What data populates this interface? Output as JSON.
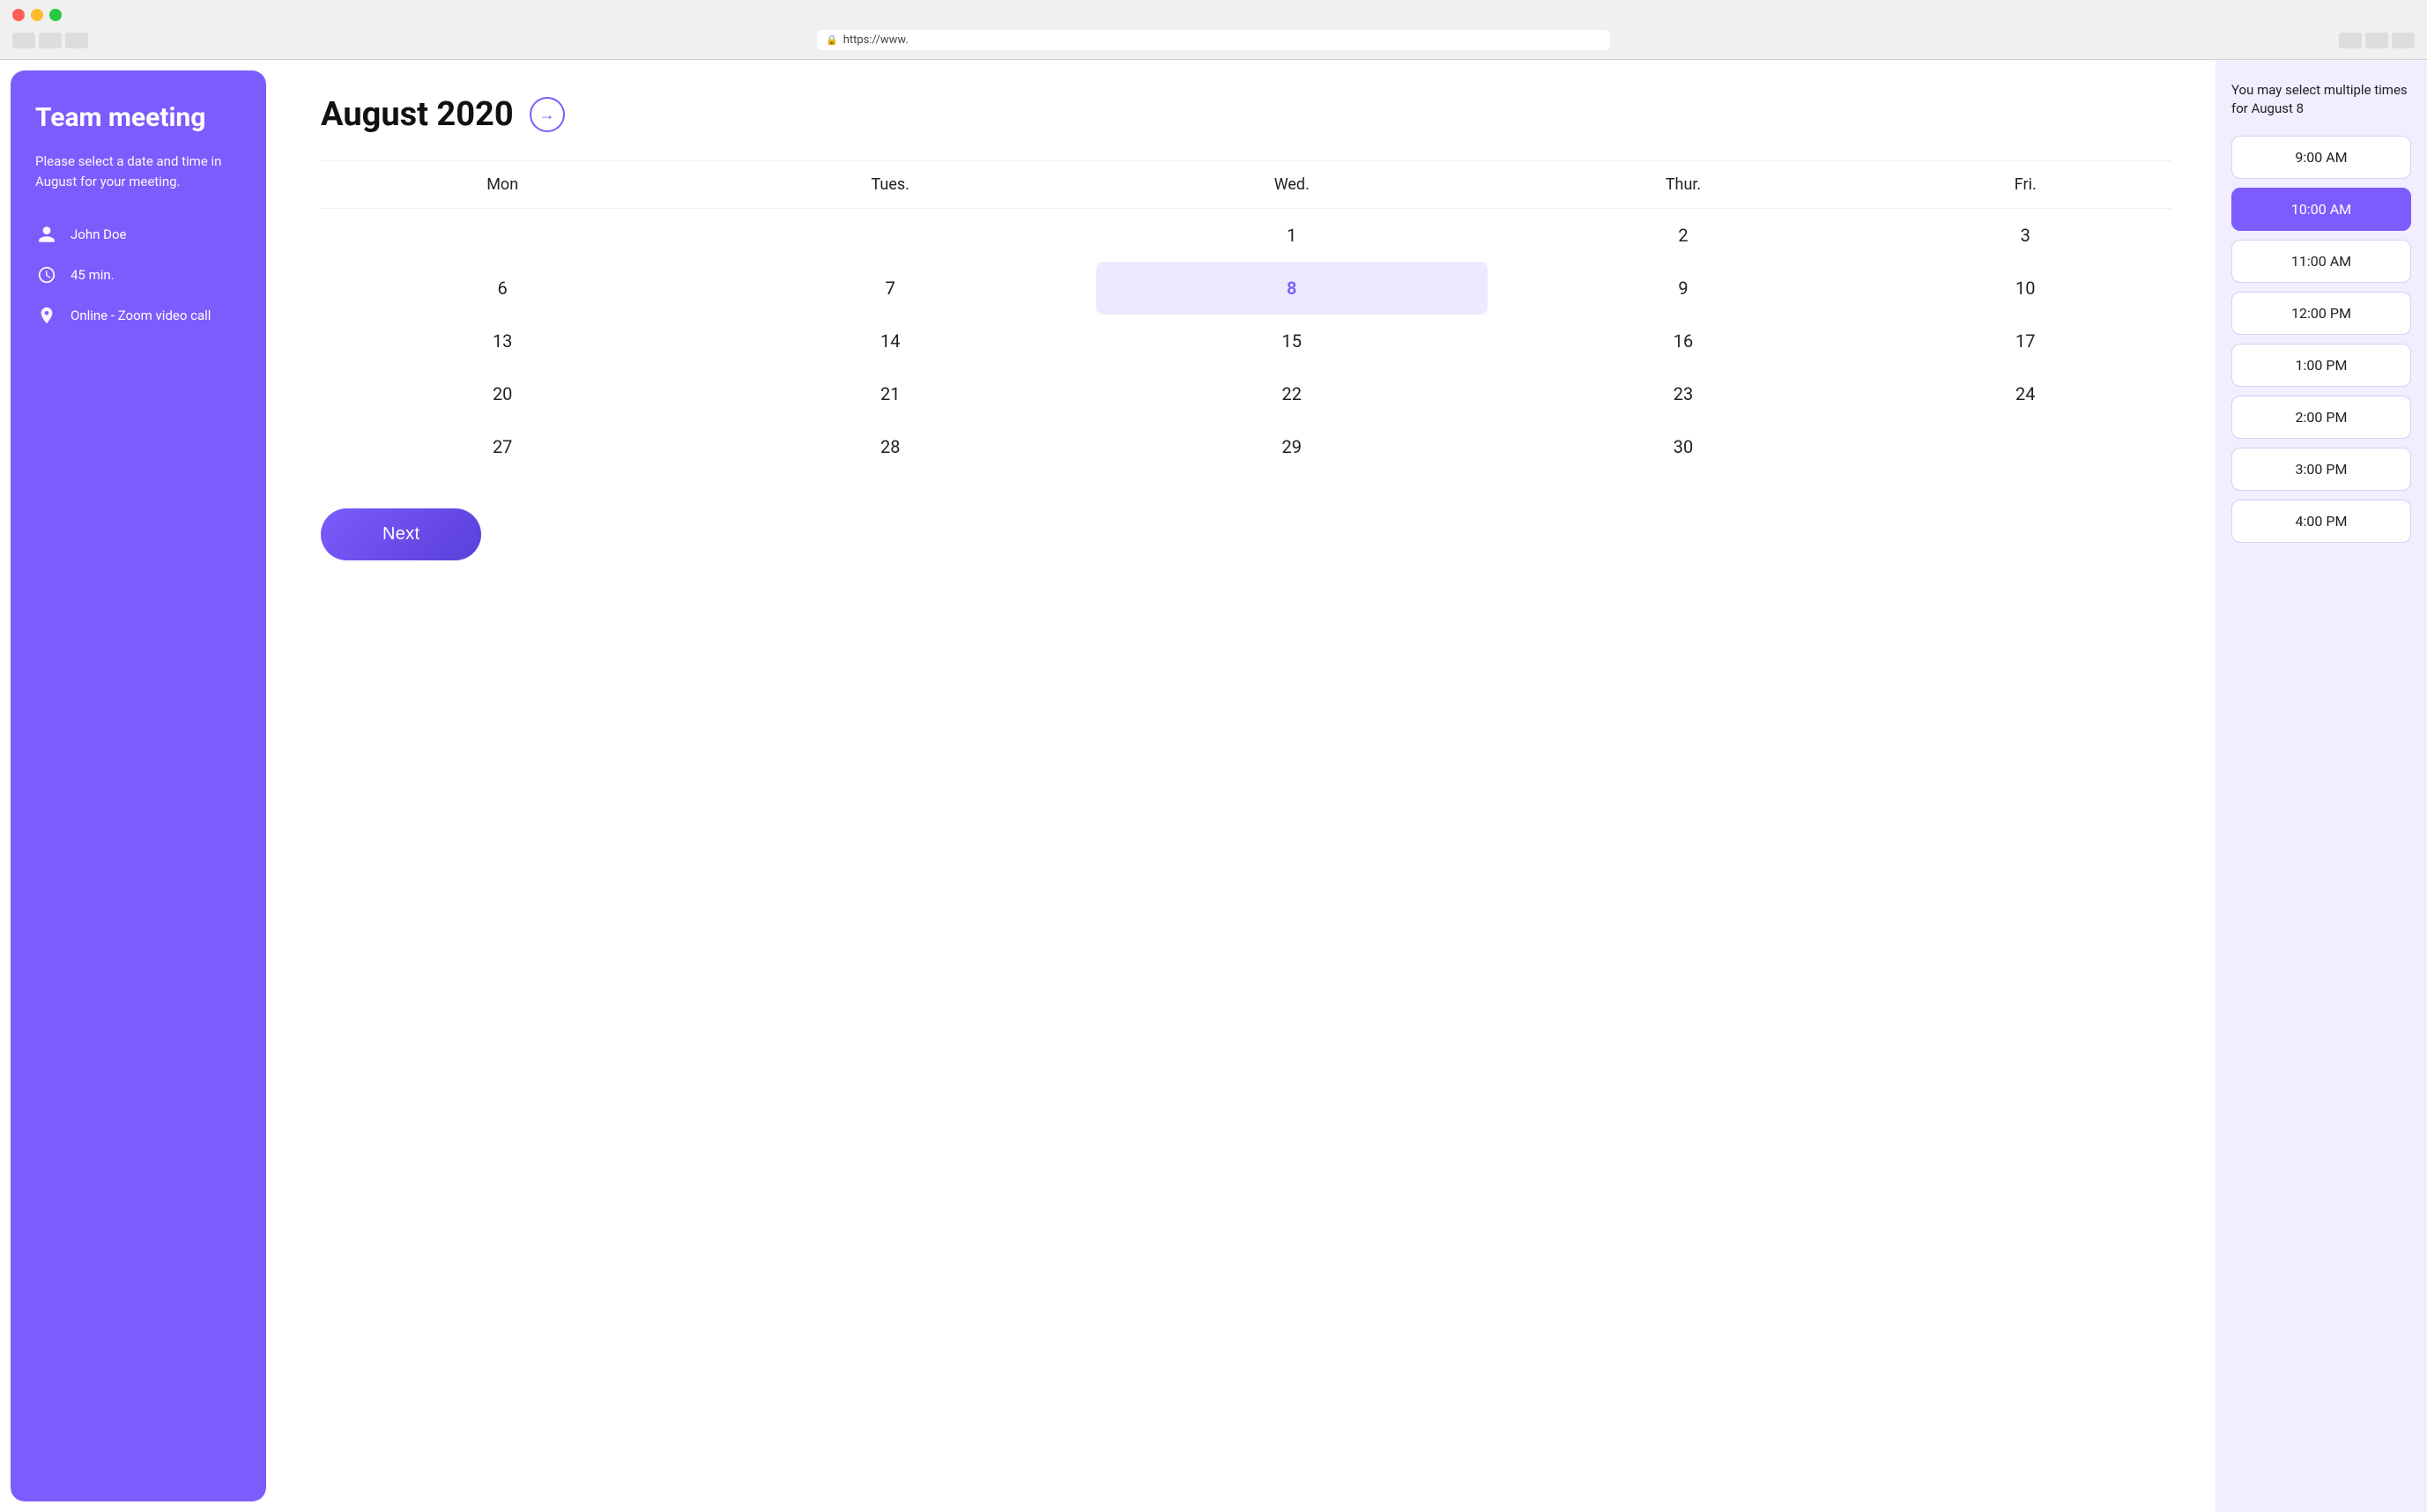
{
  "browser": {
    "url": "https://www."
  },
  "sidebar": {
    "title": "Team meeting",
    "description": "Please select a date and time in August for your meeting.",
    "attendee": "John Doe",
    "duration": "45 min.",
    "location": "Online - Zoom video call"
  },
  "calendar": {
    "title": "August 2020",
    "nav_label": "→",
    "days_of_week": [
      "Mon",
      "Tues.",
      "Wed.",
      "Thur.",
      "Fri."
    ],
    "weeks": [
      [
        "",
        "",
        "1",
        "2",
        "3"
      ],
      [
        "6",
        "7",
        "8",
        "9",
        "10"
      ],
      [
        "13",
        "14",
        "15",
        "16",
        "17"
      ],
      [
        "20",
        "21",
        "22",
        "23",
        "24"
      ],
      [
        "27",
        "28",
        "29",
        "30",
        ""
      ]
    ],
    "selected_date": "8",
    "next_button": "Next"
  },
  "time_panel": {
    "title": "You may select multiple times for August 8",
    "slots": [
      {
        "label": "9:00 AM",
        "selected": false
      },
      {
        "label": "10:00 AM",
        "selected": true
      },
      {
        "label": "11:00 AM",
        "selected": false
      },
      {
        "label": "12:00 PM",
        "selected": false
      },
      {
        "label": "1:00 PM",
        "selected": false
      },
      {
        "label": "2:00 PM",
        "selected": false
      },
      {
        "label": "3:00 PM",
        "selected": false
      },
      {
        "label": "4:00 PM",
        "selected": false
      }
    ]
  }
}
